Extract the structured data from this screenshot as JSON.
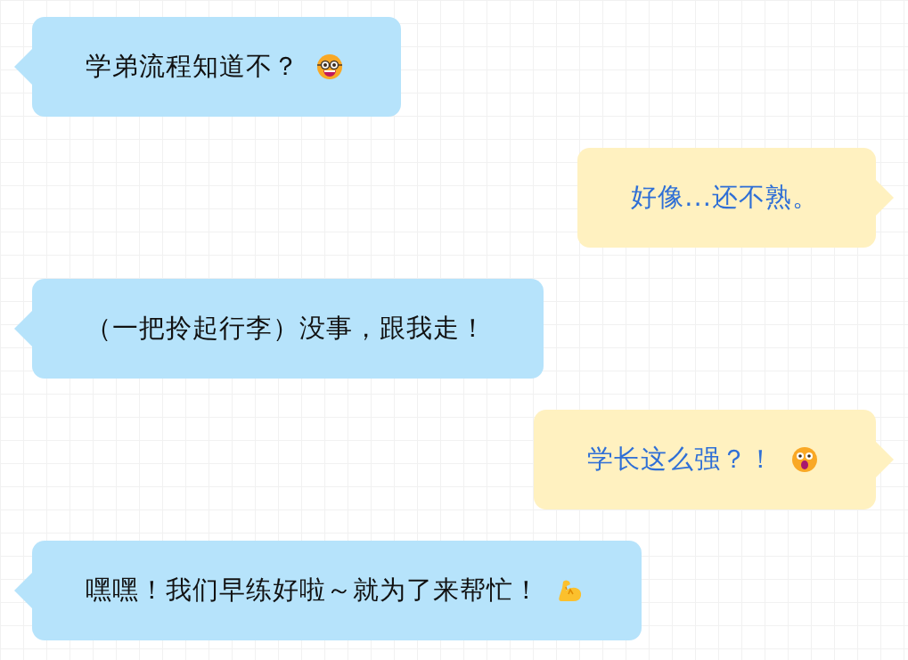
{
  "messages": [
    {
      "outgoing": false,
      "text": "学弟流程知道不？",
      "kind": "nerd"
    },
    {
      "outgoing": true,
      "text": "好像...还不熟。",
      "kind": "plain"
    },
    {
      "outgoing": false,
      "text": "（一把拎起行李）没事，跟我走！",
      "kind": "plain"
    },
    {
      "outgoing": true,
      "text": "学长这么强？！",
      "kind": "shocked"
    },
    {
      "outgoing": false,
      "text": "嘿嘿！我们早练好啦～就为了来帮忙！",
      "kind": "flex"
    }
  ]
}
